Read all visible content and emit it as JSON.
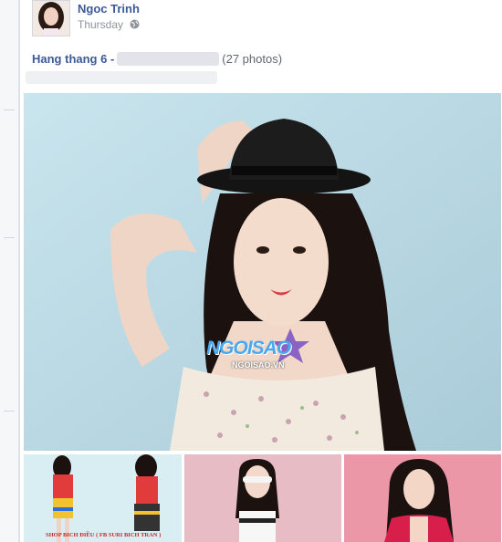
{
  "post": {
    "author_name": "Ngoc Trinh",
    "timestamp": "Thursday",
    "privacy_icon": "globe-icon"
  },
  "album": {
    "title": "Hang thang 6 -",
    "photo_count": "(27 photos)"
  },
  "photos": {
    "watermark_logo": "NGOISAO",
    "watermark_url": "NGOISAO.VN",
    "thumb1_caption": "SHOP BICH ĐIỀU ( FB SURI BICH TRAN )"
  },
  "colors": {
    "link_blue": "#3b5998",
    "meta_gray": "#90949c",
    "feed_bg": "#e9ebee"
  }
}
